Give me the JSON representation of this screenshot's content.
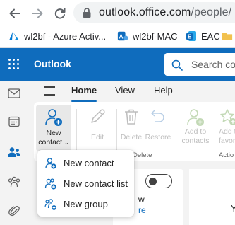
{
  "browser": {
    "url_host": "outlook.office.com",
    "url_path": "/people/",
    "bookmarks": [
      {
        "label": "wl2bf - Azure Activ...",
        "icon": "azure-icon",
        "color": "#0078d4"
      },
      {
        "label": "wl2bf-MAC",
        "icon": "mac-admin-icon",
        "color": "#0078d4"
      },
      {
        "label": "EAC",
        "icon": "exchange-icon",
        "color": "#0f6cbd"
      },
      {
        "label": "",
        "icon": "folder-icon",
        "color": "#f2c14e"
      }
    ]
  },
  "header": {
    "app_name": "Outlook",
    "search_placeholder": "Search con",
    "color": "#0f6cbd"
  },
  "ribbon": {
    "tabs": [
      "Home",
      "View",
      "Help"
    ],
    "active_tab": "Home",
    "buttons": {
      "new_contact_line1": "New",
      "new_contact_line2": "contact",
      "edit": "Edit",
      "delete": "Delete",
      "restore": "Restore",
      "add_to_contacts_line1": "Add to",
      "add_to_contacts_line2": "contacts",
      "add_to_favorites_line1": "Add t",
      "add_to_favorites_line2": "favori"
    },
    "groups": {
      "delete": "Delete",
      "actions": "Actio"
    }
  },
  "content": {
    "text_w": "w",
    "link_re": "re",
    "text_y": "Y"
  },
  "new_menu": {
    "items": [
      {
        "label": "New contact",
        "icon": "add-person-icon"
      },
      {
        "label": "New contact list",
        "icon": "add-contact-list-icon"
      },
      {
        "label": "New group",
        "icon": "add-group-icon"
      }
    ]
  },
  "colors": {
    "accent": "#0f6cbd",
    "disabled": "#bdbdbd",
    "green_disabled": "#c3d9b6"
  }
}
